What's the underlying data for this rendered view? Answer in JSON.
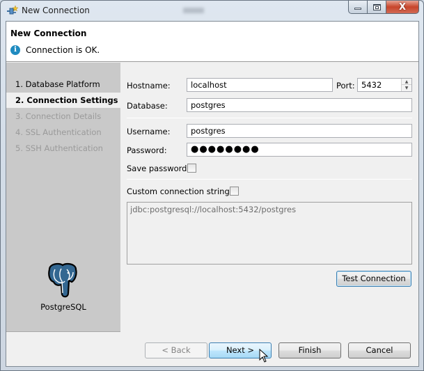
{
  "window": {
    "title": "New Connection",
    "blurred_title_text": "mysql",
    "controls": {
      "minimize": "minimize",
      "maximize": "maximize",
      "close": "X"
    }
  },
  "header": {
    "title": "New Connection",
    "status_icon": "info-icon",
    "status_message": "Connection is OK."
  },
  "nav": {
    "items": [
      {
        "label": "1. Database Platform",
        "state": "normal"
      },
      {
        "label": "2. Connection Settings",
        "state": "active"
      },
      {
        "label": "3. Connection Details",
        "state": "disabled"
      },
      {
        "label": "4. SSL Authentication",
        "state": "disabled"
      },
      {
        "label": "5. SSH Authentication",
        "state": "disabled"
      }
    ],
    "platform_icon": "postgresql-elephant-icon",
    "platform_label": "PostgreSQL"
  },
  "form": {
    "hostname_label": "Hostname:",
    "hostname_value": "localhost",
    "port_label": "Port:",
    "port_value": "5432",
    "database_label": "Database:",
    "database_value": "postgres",
    "username_label": "Username:",
    "username_value": "postgres",
    "password_label": "Password:",
    "password_value": "●●●●●●●●",
    "save_password_label": "Save password:",
    "save_password_checked": false,
    "custom_conn_label": "Custom connection string:",
    "custom_conn_checked": false,
    "connection_string": "jdbc:postgresql://localhost:5432/postgres",
    "test_connection_label": "Test Connection"
  },
  "footer": {
    "back_label": "< Back",
    "next_label": "Next >",
    "finish_label": "Finish",
    "cancel_label": "Cancel"
  },
  "colors": {
    "info_blue": "#1f8bc0",
    "nav_bg": "#c9c9c9",
    "client_bg": "#f0f0f0",
    "close_red": "#c7452b",
    "pg_blue": "#336791"
  }
}
